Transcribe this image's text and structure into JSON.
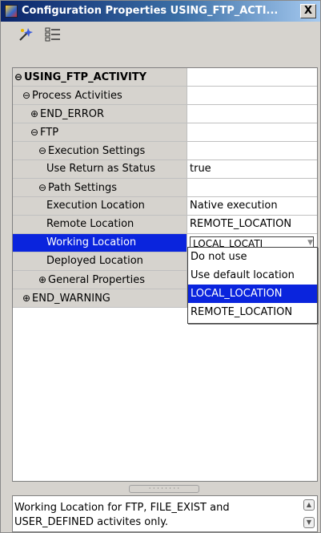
{
  "window": {
    "title": "Configuration Properties USING_FTP_ACTI...",
    "close_label": "X"
  },
  "toolbar": {
    "buttons": [
      {
        "icon": "wand-icon"
      },
      {
        "icon": "list-view-icon"
      }
    ]
  },
  "tree": {
    "rows": [
      {
        "label": "USING_FTP_ACTIVITY",
        "expander": "⊖",
        "value": ""
      },
      {
        "label": "Process Activities",
        "expander": "⊖",
        "value": ""
      },
      {
        "label": "END_ERROR",
        "expander": "⊕",
        "value": ""
      },
      {
        "label": "FTP",
        "expander": "⊖",
        "value": ""
      },
      {
        "label": "Execution Settings",
        "expander": "⊖",
        "value": ""
      },
      {
        "label": "Use Return as Status",
        "expander": "",
        "value": "true"
      },
      {
        "label": "Path Settings",
        "expander": "⊖",
        "value": ""
      },
      {
        "label": "Execution Location",
        "expander": "",
        "value": "Native execution"
      },
      {
        "label": "Remote Location",
        "expander": "",
        "value": "REMOTE_LOCATION"
      },
      {
        "label": "Working Location",
        "expander": "",
        "value": "LOCAL_LOCATI..."
      },
      {
        "label": "Deployed Location",
        "expander": "",
        "value": ""
      },
      {
        "label": "General Properties",
        "expander": "⊕",
        "value": ""
      },
      {
        "label": "END_WARNING",
        "expander": "⊕",
        "value": ""
      }
    ]
  },
  "dropdown": {
    "current": "LOCAL_LOCATI",
    "options": [
      "Do not use",
      "Use default location",
      "LOCAL_LOCATION",
      "REMOTE_LOCATION"
    ],
    "selected_index": 2
  },
  "splitter": {
    "grip": "· · · · · · · ·"
  },
  "description": {
    "text": "Working Location for FTP, FILE_EXIST and USER_DEFINED activites only."
  }
}
